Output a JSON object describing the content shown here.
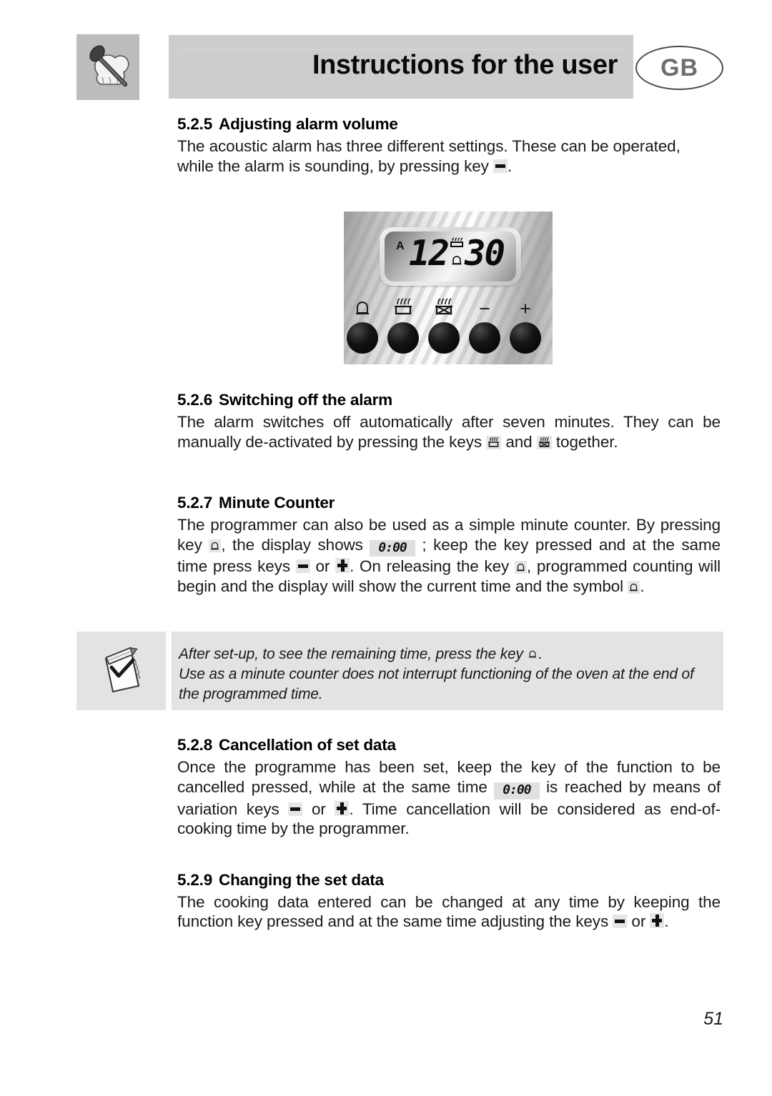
{
  "header": {
    "title": "Instructions for the user",
    "language_badge": "GB",
    "icon_name": "spoon-and-chef-hat-icon"
  },
  "sections": [
    {
      "number": "5.2.5",
      "title": "Adjusting alarm volume",
      "body_before": "The acoustic alarm has three different settings. These can be operated, while the alarm is sounding, by pressing key ",
      "body_after": "."
    },
    {
      "number": "5.2.6",
      "title": "Switching off the alarm",
      "body_1": "The alarm switches off automatically after seven minutes. They can be manually de-activated by pressing the keys ",
      "body_2": " and ",
      "body_3": " together."
    },
    {
      "number": "5.2.7",
      "title": "Minute Counter",
      "body_1": "The programmer can also be used as a simple minute counter. By pressing key ",
      "body_2": ", the display shows ",
      "lcd_value": "0:00",
      "body_3": " ; keep the key pressed and at the same time press keys ",
      "body_4": " or ",
      "body_5": ". On releasing the key ",
      "body_6": ", programmed counting will begin and the display will show the current time and the symbol ",
      "body_7": "."
    },
    {
      "number": "5.2.8",
      "title": "Cancellation of set data",
      "body_1": "Once the programme has been set, keep the key of the function to be cancelled pressed, while at the same time ",
      "lcd_value": "0:00",
      "body_2": " is reached by means of variation keys ",
      "body_3": " or ",
      "body_4": ". Time cancellation will be considered as end-of-cooking time by the programmer."
    },
    {
      "number": "5.2.9",
      "title": "Changing the set data",
      "body_1": "The cooking data entered can be changed at any time by keeping the function key pressed and at the same time adjusting the keys ",
      "body_2": " or ",
      "body_3": "."
    }
  ],
  "panel_figure": {
    "display": {
      "mode_indicator": "A",
      "hours": "12",
      "minutes": "30",
      "icon_top": "cooking-heat-icon",
      "icon_bottom": "bell-icon"
    },
    "keys": [
      {
        "icon": "bell-icon",
        "label": "",
        "name": "alarm-key"
      },
      {
        "icon": "cooking-start-icon",
        "label": "",
        "name": "cooking-time-key"
      },
      {
        "icon": "cooking-end-icon",
        "label": "",
        "name": "end-cooking-time-key"
      },
      {
        "icon": "minus-icon",
        "label": "−",
        "name": "decrease-key"
      },
      {
        "icon": "plus-icon",
        "label": "+",
        "name": "increase-key"
      }
    ]
  },
  "note": {
    "icon_name": "notepad-checkmark-icon",
    "line_1_before": "After set-up, to see the remaining time, press the key ",
    "line_1_after": ".",
    "line_2": "Use as a minute counter does not interrupt functioning of the oven at the end of the programmed time."
  },
  "footer": {
    "page_number": "51"
  },
  "colors": {
    "header_bar": "#cdcdcd",
    "header_icon_bg": "#bcbcbc",
    "note_bg": "#e3e3e3",
    "key_symbol_bg": "#e6e6e6",
    "text": "#1a1a1a"
  }
}
